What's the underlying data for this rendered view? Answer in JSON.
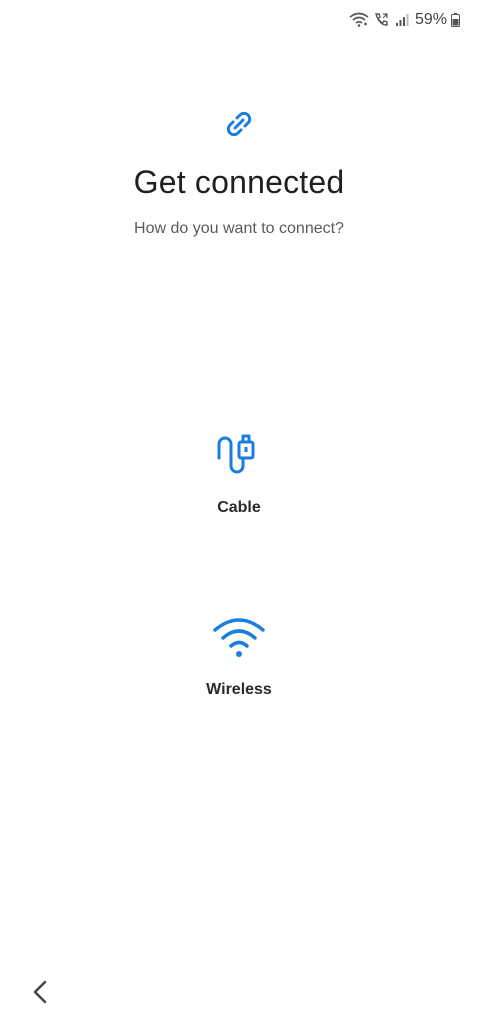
{
  "status_bar": {
    "battery": "59%",
    "icons": [
      "wifi-calling-icon",
      "call-icon",
      "signal-icon",
      "battery-icon"
    ]
  },
  "header": {
    "icon": "link-icon",
    "title": "Get connected",
    "subtitle": "How do you want to connect?"
  },
  "options": [
    {
      "icon": "cable-icon",
      "label": "Cable"
    },
    {
      "icon": "wifi-icon",
      "label": "Wireless"
    }
  ],
  "nav": {
    "back_icon": "chevron-left-icon"
  },
  "colors": {
    "accent": "#1a7de0",
    "text": "#202020",
    "subtext": "#5a5a5a"
  }
}
